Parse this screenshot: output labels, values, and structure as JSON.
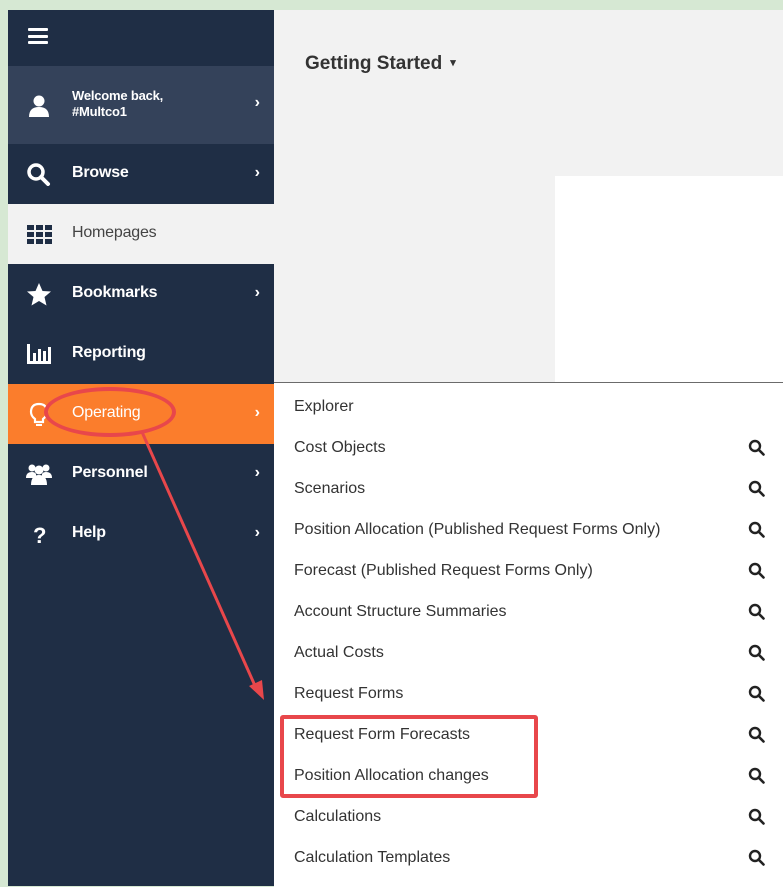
{
  "sidebar": {
    "welcome": {
      "greeting": "Welcome back,",
      "user": "#Multco1"
    },
    "items": [
      {
        "label": "Browse",
        "icon": "search-icon"
      },
      {
        "label": "Homepages",
        "icon": "grid-icon"
      },
      {
        "label": "Bookmarks",
        "icon": "star-icon"
      },
      {
        "label": "Reporting",
        "icon": "bar-chart-icon"
      },
      {
        "label": "Operating",
        "icon": "lightbulb-icon"
      },
      {
        "label": "Personnel",
        "icon": "users-icon"
      },
      {
        "label": "Help",
        "icon": "question-icon"
      }
    ]
  },
  "main": {
    "title": "Getting Started",
    "caret": "▾"
  },
  "dropdown": {
    "items": [
      {
        "label": "Explorer"
      },
      {
        "label": "Cost Objects"
      },
      {
        "label": "Scenarios"
      },
      {
        "label": "Position Allocation (Published Request Forms Only)"
      },
      {
        "label": "Forecast (Published Request Forms Only)"
      },
      {
        "label": "Account Structure Summaries"
      },
      {
        "label": "Actual Costs"
      },
      {
        "label": "Request Forms"
      },
      {
        "label": "Request Form Forecasts"
      },
      {
        "label": "Position Allocation changes"
      },
      {
        "label": "Calculations"
      },
      {
        "label": "Calculation Templates"
      }
    ]
  },
  "colors": {
    "sidebar_bg": "#1f2e45",
    "active_orange": "#fb7d2c",
    "annotation_red": "#e8474b"
  }
}
